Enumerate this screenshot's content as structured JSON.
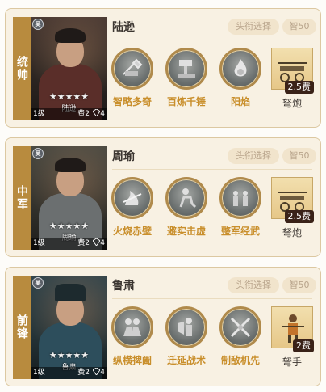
{
  "cards": [
    {
      "position": "统帅",
      "name": "陆逊",
      "portrait_name": "陆逊",
      "stars": "★★★★★",
      "faction": "吴",
      "level": "1级",
      "cost": "费2",
      "rank": "4",
      "title_button": "头衔选择",
      "intelligence": "智50",
      "skills": [
        "智略多奇",
        "百炼千锤",
        "阳焰"
      ],
      "troop": {
        "name": "弩炮",
        "cost": "2.5费"
      }
    },
    {
      "position": "中军",
      "name": "周瑜",
      "portrait_name": "周瑜",
      "stars": "★★★★★",
      "faction": "吴",
      "level": "1级",
      "cost": "费2",
      "rank": "4",
      "title_button": "头衔选择",
      "intelligence": "智50",
      "skills": [
        "火烧赤壁",
        "避实击虚",
        "整军经武"
      ],
      "troop": {
        "name": "弩炮",
        "cost": "2.5费"
      }
    },
    {
      "position": "前锋",
      "name": "鲁肃",
      "portrait_name": "鲁肃",
      "stars": "★★★★★",
      "faction": "吴",
      "level": "1级",
      "cost": "费2",
      "rank": "4",
      "title_button": "头衔选择",
      "intelligence": "智50",
      "skills": [
        "纵横捭阖",
        "迁延战术",
        "制敌机先"
      ],
      "troop": {
        "name": "弩手",
        "cost": "2费"
      }
    }
  ],
  "colors": {
    "accent_gold": "#b88b3e",
    "skill_text": "#c98f2c",
    "card_bg": "#f8f1e3",
    "badge_bg": "#f1e4cc"
  },
  "icons": {
    "faction": "wu-faction-icon",
    "rank": "rank-shield-icon"
  }
}
